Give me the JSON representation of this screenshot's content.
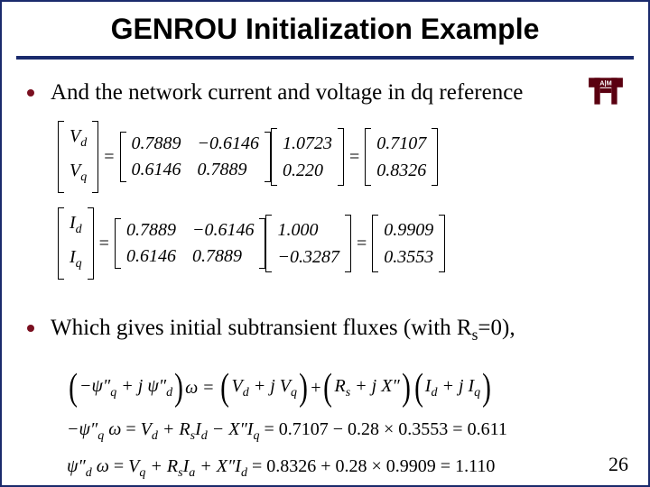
{
  "title": "GENROU Initialization Example",
  "logo_label": "A|M",
  "pagenum": "26",
  "bullets": [
    "And the network current and voltage in dq reference",
    "Which gives initial subtransient fluxes (with R",
    "=0),"
  ],
  "sub_s": "s",
  "eq1": {
    "lhs_top": "V",
    "lhs_top_sub": "d",
    "lhs_bot": "V",
    "lhs_bot_sub": "q",
    "m11": "0.7889",
    "m12": "−0.6146",
    "m21": "0.6146",
    "m22": "0.7889",
    "v1": "1.0723",
    "v2": "0.220",
    "r1": "0.7107",
    "r2": "0.8326"
  },
  "eq2": {
    "lhs_top": "I",
    "lhs_top_sub": "d",
    "lhs_bot": "I",
    "lhs_bot_sub": "q",
    "m11": "0.7889",
    "m12": "−0.6146",
    "m21": "0.6146",
    "m22": "0.7889",
    "v1": "1.000",
    "v2": "−0.3287",
    "r1": "0.9909",
    "r2": "0.3553"
  },
  "eq3": {
    "lhs": "(−ψ″_q + j ψ″_d) ω",
    "rhs_a_top": "V_d + j V_q",
    "rhs_b_inner": "R_s + j X″",
    "rhs_c_top": "I_d + j I_q"
  },
  "eq4": "−ψ″_q ω = V_d + R_s I_d − X″ I_q = 0.7107 − 0.28 × 0.3553 = 0.611",
  "eq5": "ψ″_d ω = V_q + R_s I_a + X″ I_d = 0.8326 + 0.28 × 0.9909 = 1.110",
  "chart_data": [
    {
      "type": "table",
      "title": "dq transform of voltage",
      "lhs": [
        "V_d",
        "V_q"
      ],
      "matrix": [
        [
          0.7889,
          -0.6146
        ],
        [
          0.6146,
          0.7889
        ]
      ],
      "input": [
        1.0723,
        0.22
      ],
      "result": [
        0.7107,
        0.8326
      ]
    },
    {
      "type": "table",
      "title": "dq transform of current",
      "lhs": [
        "I_d",
        "I_q"
      ],
      "matrix": [
        [
          0.7889,
          -0.6146
        ],
        [
          0.6146,
          0.7889
        ]
      ],
      "input": [
        1.0,
        -0.3287
      ],
      "result": [
        0.9909,
        0.3553
      ]
    },
    {
      "type": "table",
      "title": "subtransient flux results",
      "rows": [
        {
          "name": "-psi''_q * omega",
          "Vd": 0.7107,
          "X": 0.28,
          "Iq": 0.3553,
          "value": 0.611
        },
        {
          "name": "psi''_d * omega",
          "Vq": 0.8326,
          "X": 0.28,
          "Id": 0.9909,
          "value": 1.11
        }
      ]
    }
  ]
}
